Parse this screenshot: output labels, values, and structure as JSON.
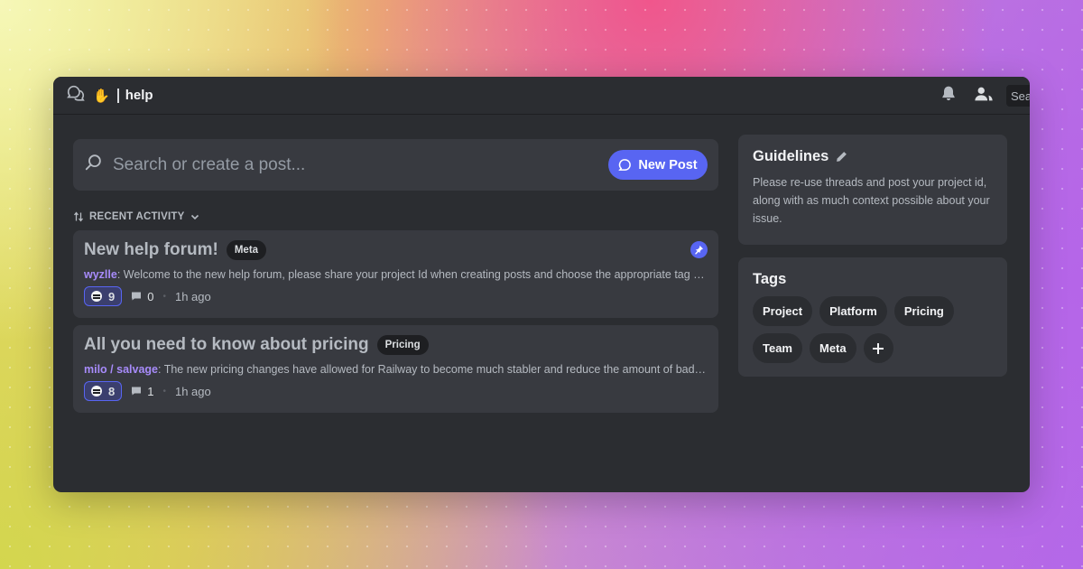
{
  "header": {
    "emoji": "✋",
    "channel": "help",
    "search_partial": "Sea"
  },
  "search": {
    "placeholder": "Search or create a post...",
    "new_post_label": "New Post"
  },
  "sort": {
    "label": "RECENT ACTIVITY"
  },
  "posts": [
    {
      "title": "New help forum!",
      "tag": "Meta",
      "author": "wyzlle",
      "preview": ": Welcome to the new help forum, please share your project Id when creating posts and choose the appropriate tag tha…",
      "reactions": "9",
      "messages": "0",
      "time": "1h ago",
      "pinned": true
    },
    {
      "title": "All you need to know about pricing",
      "tag": "Pricing",
      "author": "milo / salvage",
      "preview": ": The new pricing changes have allowed for Railway to become much stabler and reduce the amount of bad act…",
      "reactions": "8",
      "messages": "1",
      "time": "1h ago",
      "pinned": false
    }
  ],
  "guidelines": {
    "title": "Guidelines",
    "body": "Please re-use threads and post your project id, along with as much context possible about your issue."
  },
  "tags": {
    "title": "Tags",
    "items": [
      "Project",
      "Platform",
      "Pricing",
      "Team",
      "Meta"
    ]
  },
  "colors": {
    "accent": "#5865f2",
    "author": "#a78bfa",
    "window_bg": "#2b2d31",
    "card_bg": "#383a40"
  }
}
